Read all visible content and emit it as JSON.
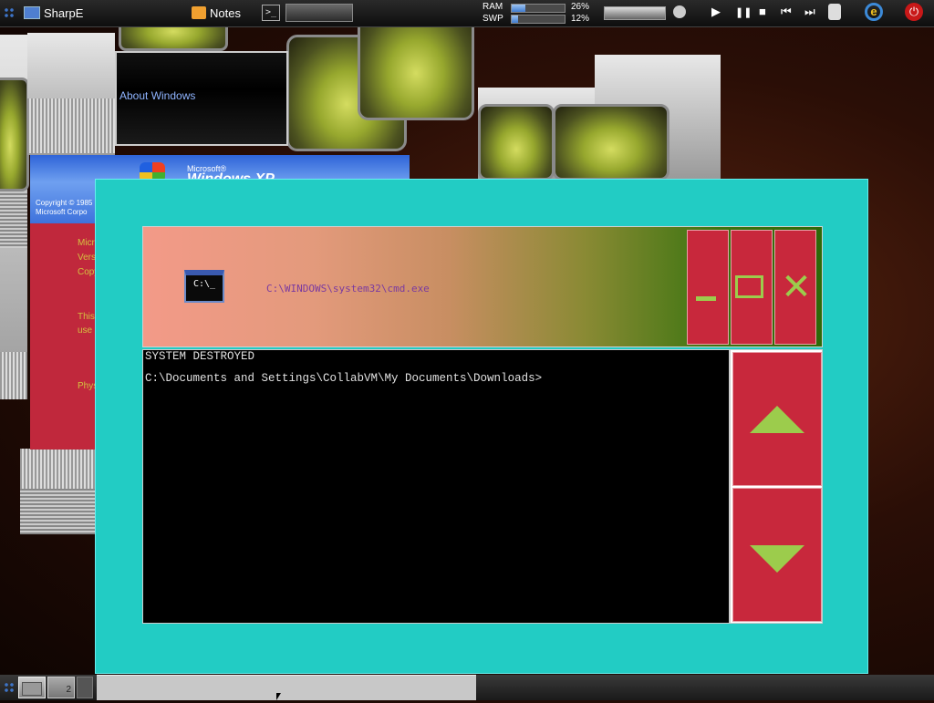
{
  "topbar": {
    "app_label": "SharpE",
    "notes_label": "Notes",
    "cmd_button_glyph": ">_",
    "ram_label": "RAM",
    "ram_percent": "26%",
    "ram_fraction": 0.26,
    "swp_label": "SWP",
    "swp_percent": "12%",
    "swp_fraction": 0.12,
    "media": {
      "play": "▶",
      "pause": "❚❚",
      "stop": "■",
      "prev": "⏮",
      "next": "⏭"
    }
  },
  "background": {
    "about_windows_label": "About Windows",
    "xp_microsoft": "Microsoft®",
    "xp_windows": "Windows XP",
    "xp_copyright_1": "Copyright © 1985",
    "xp_copyright_2": "Microsoft Corpo",
    "red_lines": [
      "Micr",
      "Vers",
      "Copy",
      "This",
      "use",
      "Phys"
    ]
  },
  "cmd_window": {
    "icon_text": "C:\\_",
    "title": "C:\\WINDOWS\\system32\\cmd.exe",
    "console_lines": [
      "SYSTEM DESTROYED",
      "C:\\Documents and Settings\\CollabVM\\My Documents\\Downloads>"
    ],
    "close_glyph": "✕"
  },
  "taskbar": {
    "desktop_2_label": "2"
  },
  "colors": {
    "window_frame": "#22ccc4",
    "button_red": "#c8283c",
    "accent_green": "#9ccc4c"
  }
}
